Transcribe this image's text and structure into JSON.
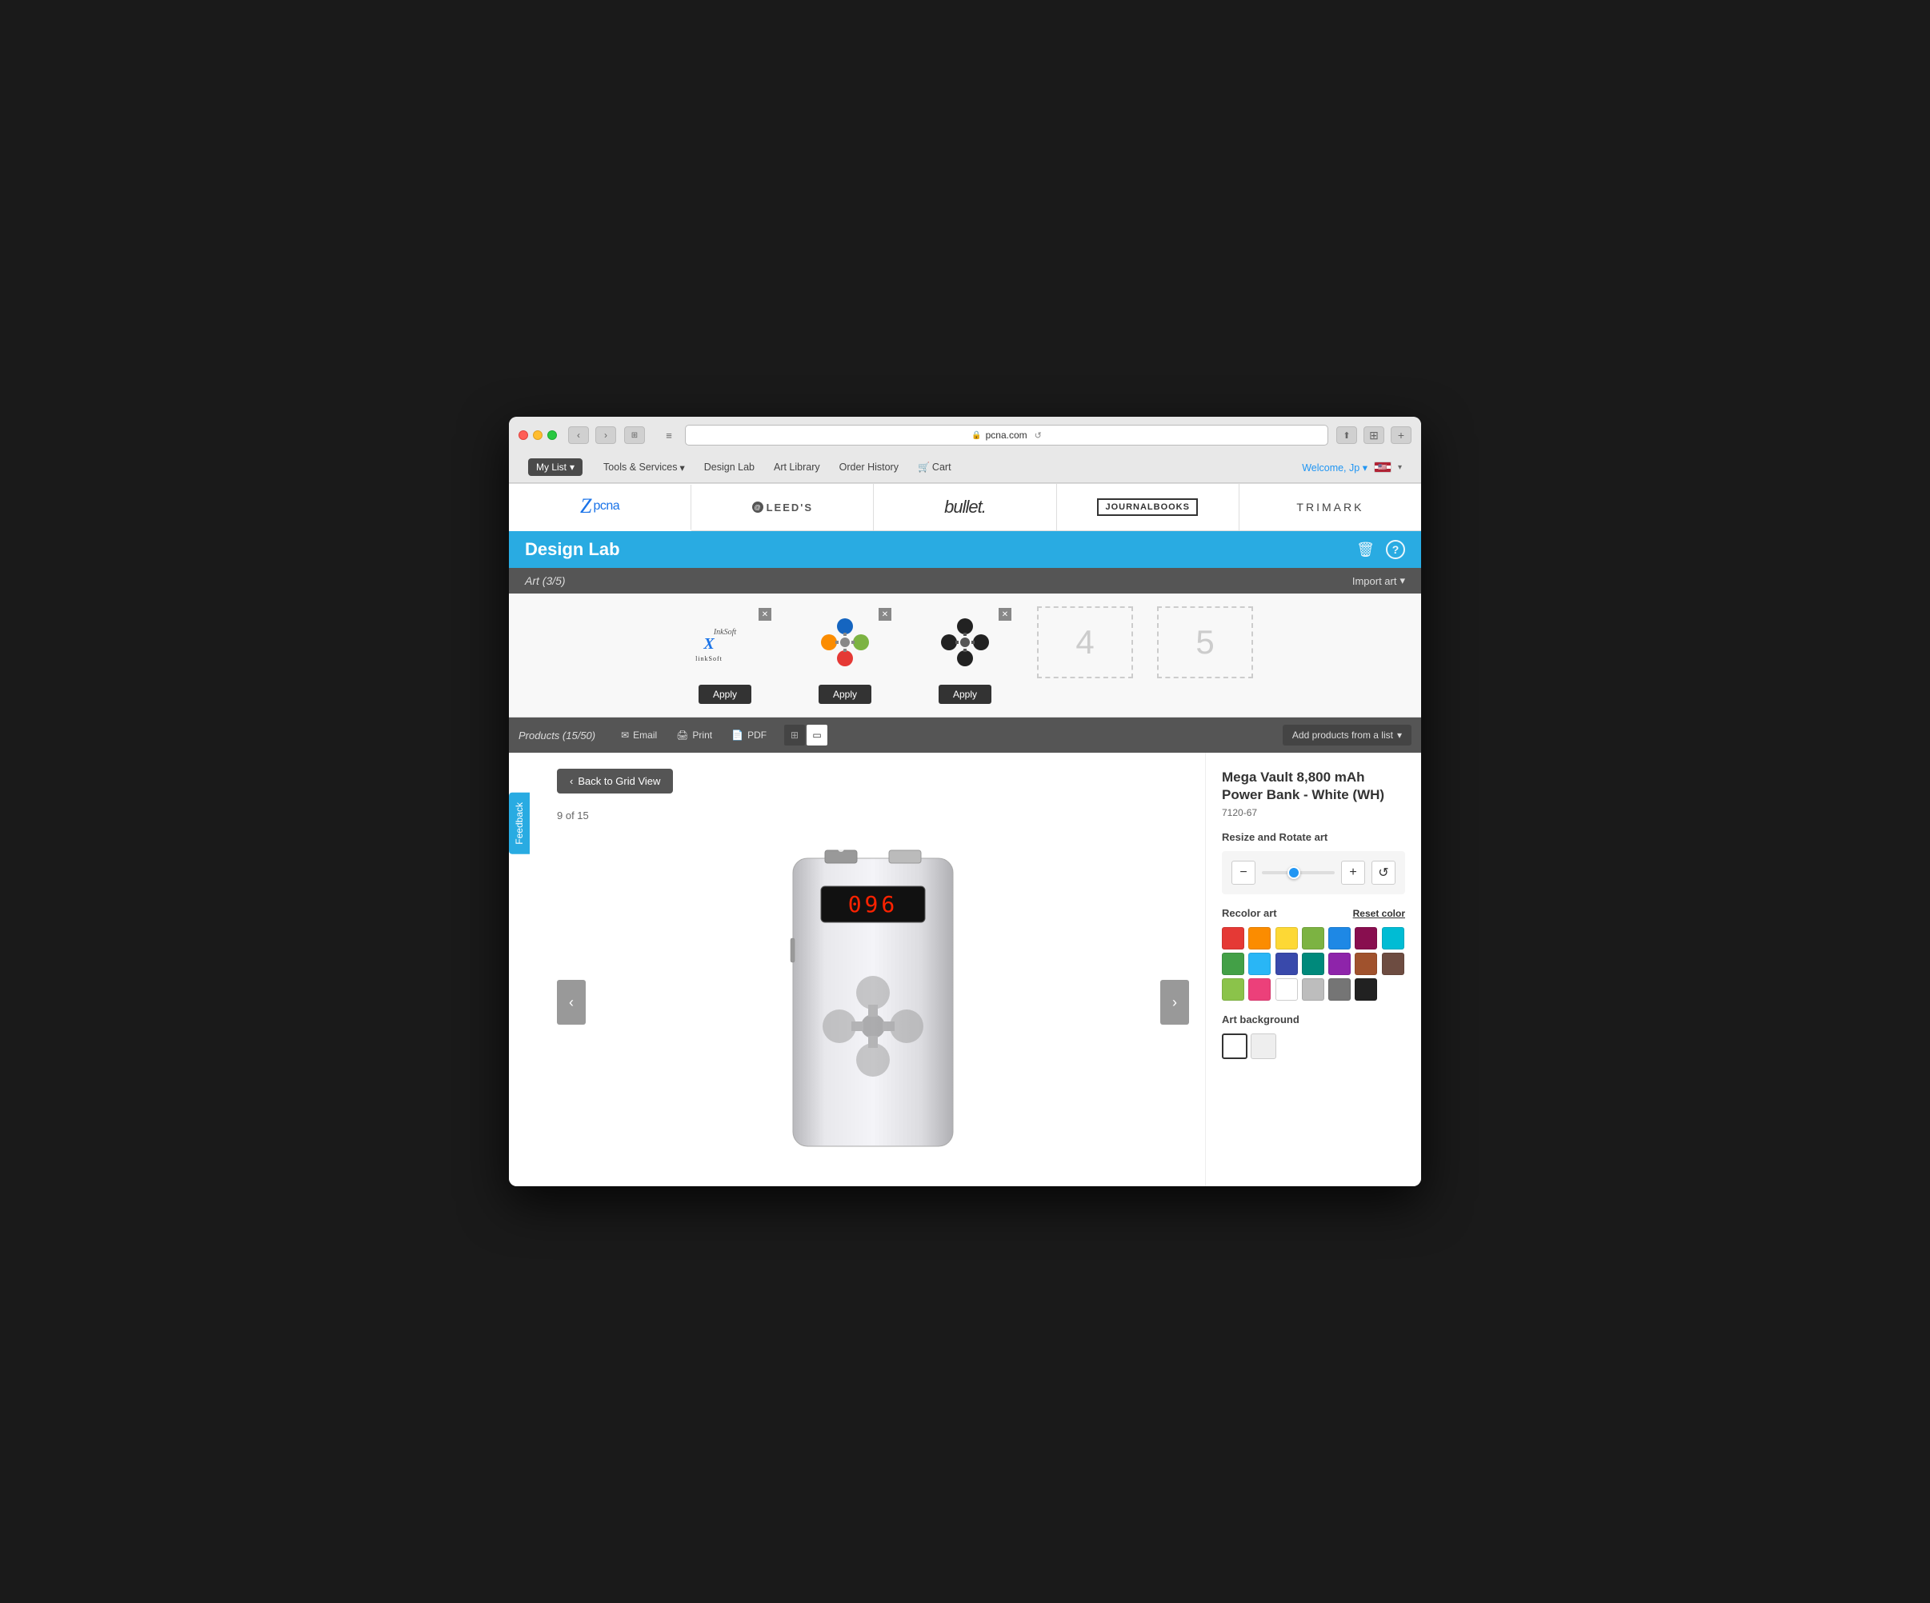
{
  "browser": {
    "url": "pcna.com",
    "reload_icon": "↺"
  },
  "nav": {
    "my_list": "My List",
    "tools_services": "Tools & Services",
    "design_lab": "Design Lab",
    "art_library": "Art Library",
    "order_history": "Order History",
    "cart": "Cart",
    "welcome": "Welcome, Jp",
    "chevron": "▾"
  },
  "brands": [
    {
      "name": "pcna",
      "label": "ZPCNA"
    },
    {
      "name": "leeds",
      "label": "LEEDS"
    },
    {
      "name": "bullet",
      "label": "bullet."
    },
    {
      "name": "journalbooks",
      "label": "JOURNALBOOKS"
    },
    {
      "name": "trimark",
      "label": "TRIMARK"
    }
  ],
  "design_lab": {
    "title": "Design Lab",
    "trash_icon": "🗑",
    "help_icon": "?"
  },
  "art": {
    "label": "Art (3/5)",
    "import_label": "Import art",
    "slots": [
      {
        "id": 1,
        "has_art": true,
        "art_type": "inksoft"
      },
      {
        "id": 2,
        "has_art": true,
        "art_type": "color_cross"
      },
      {
        "id": 3,
        "has_art": true,
        "art_type": "dark_cross"
      },
      {
        "id": 4,
        "has_art": false,
        "placeholder": "4"
      },
      {
        "id": 5,
        "has_art": false,
        "placeholder": "5"
      }
    ],
    "apply_label": "Apply"
  },
  "products": {
    "label": "Products (15/50)",
    "email": "Email",
    "print": "Print",
    "pdf": "PDF",
    "add_from_list": "Add products from a list"
  },
  "feedback_tab": "Feedback",
  "back_button": "Back to Grid View",
  "product_counter": "9 of 15",
  "product": {
    "name": "Mega Vault 8,800 mAh Power Bank - White (WH)",
    "sku": "7120-67",
    "display_text": "096"
  },
  "resize": {
    "label": "Resize and Rotate art",
    "minus": "−",
    "plus": "+",
    "rotate": "↺"
  },
  "recolor": {
    "label": "Recolor art",
    "reset_label": "Reset color",
    "colors": [
      "#E53935",
      "#FB8C00",
      "#FDD835",
      "#7CB342",
      "#1E88E5",
      "#880E4F",
      "#00BCD4",
      "#43A047",
      "#29B6F6",
      "#3949AB",
      "#00897B",
      "#8E24AA",
      "#A0522D",
      "#6D4C41",
      "#8BC34A",
      "#EC407A",
      "#FFFFFF",
      "#BDBDBD",
      "#757575",
      "#212121"
    ]
  },
  "art_background": {
    "label": "Art background"
  }
}
